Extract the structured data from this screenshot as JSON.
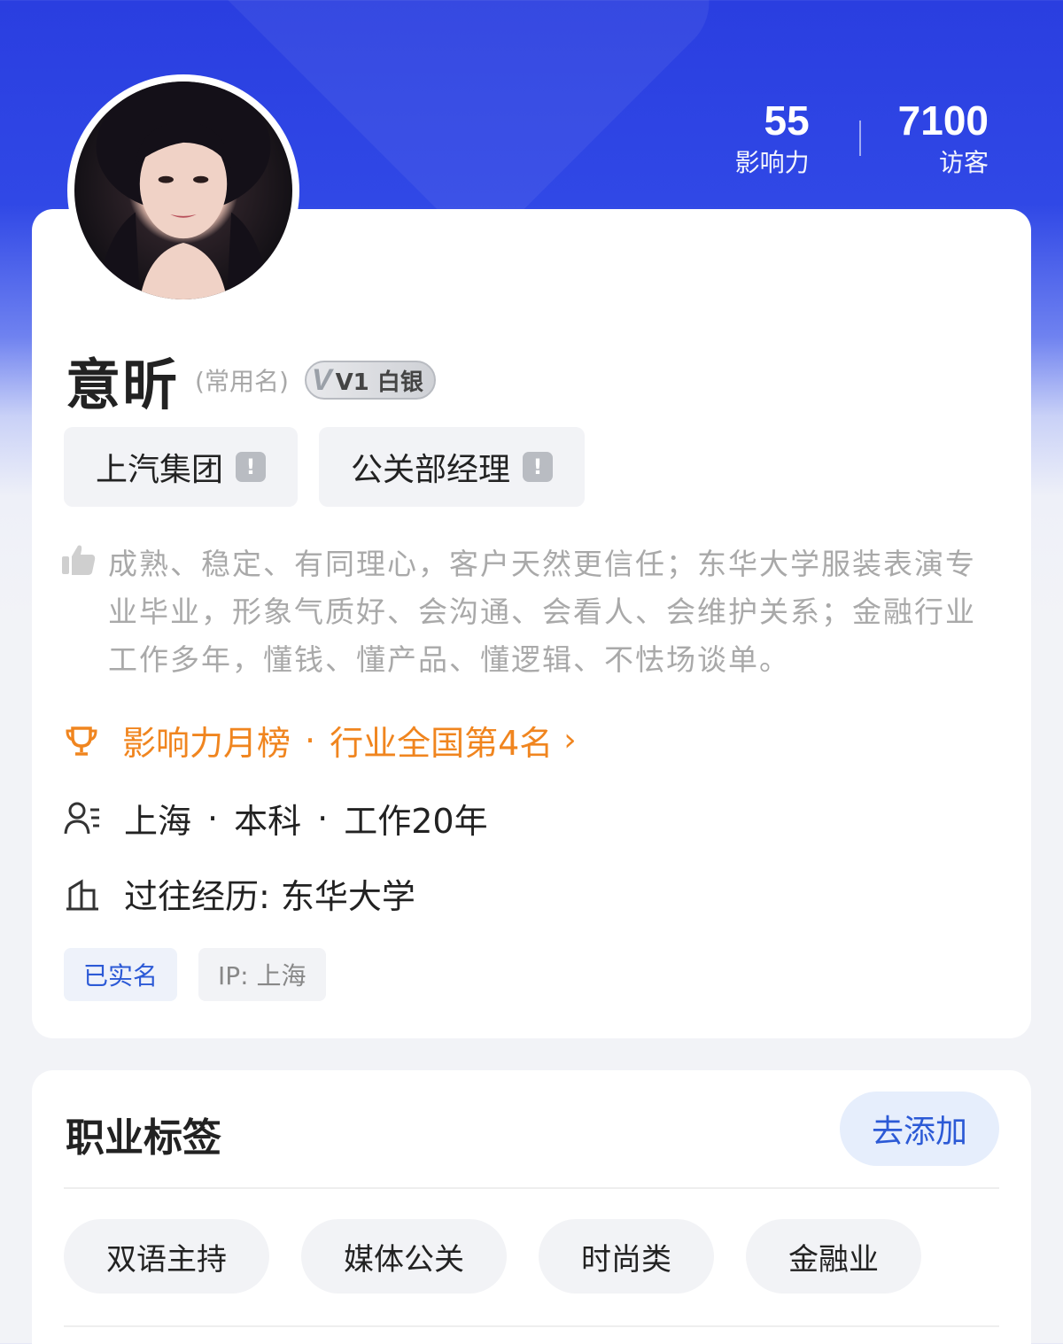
{
  "header": {
    "stats": [
      {
        "value": "55",
        "label": "影响力"
      },
      {
        "value": "7100",
        "label": "访客"
      }
    ]
  },
  "profile": {
    "name": "意昕",
    "nickname_note": "(常用名)",
    "badge": {
      "letter": "V",
      "text": "V1 白银"
    },
    "chips": [
      {
        "label": "上汽集团",
        "icon": "warning-icon"
      },
      {
        "label": "公关部经理",
        "icon": "warning-icon"
      }
    ],
    "description": "成熟、稳定、有同理心，客户天然更信任；东华大学服装表演专业毕业，形象气质好、会沟通、会看人、会维护关系；金融行业工作多年，懂钱、懂产品、懂逻辑、不怯场谈单。",
    "ranking": {
      "part1": "影响力月榜",
      "sep": "·",
      "part2": "行业全国第4名",
      "arrow": "›"
    },
    "info": {
      "city": "上海",
      "sep": "·",
      "education": "本科",
      "experience": "工作20年"
    },
    "history": "过往经历: 东华大学",
    "small_tags": [
      "已实名",
      "IP: 上海"
    ]
  },
  "career_tags": {
    "title": "职业标签",
    "add_label": "去添加",
    "tags": [
      "双语主持",
      "媒体公关",
      "时尚类",
      "金融业"
    ]
  },
  "colors": {
    "header_blue": "#2a3ee0",
    "rank_orange": "#f0851f",
    "link_blue": "#2c5ad6"
  }
}
